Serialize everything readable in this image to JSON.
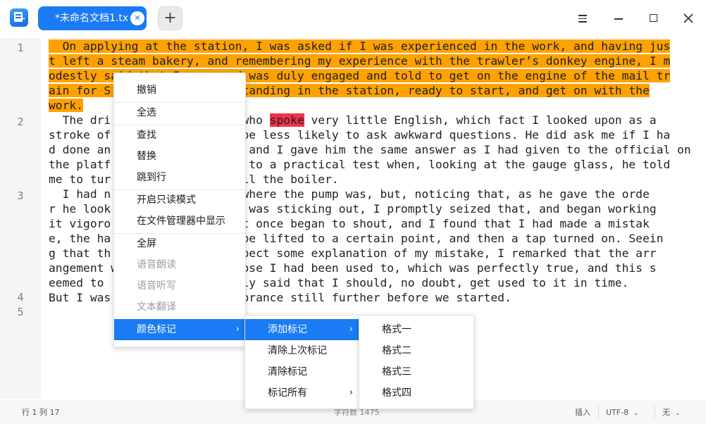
{
  "window": {
    "tab_title": "*未命名文档1.txt",
    "add_tab_label": "+",
    "close_tab_glyph": "✕",
    "buttons": [
      "menu-icon",
      "minimize-icon",
      "maximize-icon",
      "close-icon"
    ]
  },
  "editor": {
    "line_numbers": [
      "1",
      "2",
      "3",
      "4",
      "5"
    ],
    "lines": [
      {
        "parts": [
          {
            "text": "  On applying at the station, I was asked if I was experienced in the work, and having jus",
            "sel": true
          }
        ]
      },
      {
        "parts": [
          {
            "text": "t left a steam bakery, and remembering my experience with the trawler’s donkey engine, I m",
            "sel": true
          }
        ]
      },
      {
        "parts": [
          {
            "text": "odestly said that I was, and was duly engaged and told to get on the engine of the mail tr",
            "sel": true
          }
        ]
      },
      {
        "parts": [
          {
            "text": "ain for S...ead, which was standing in the station, ready to start, and get on with the",
            "sel": true
          }
        ]
      },
      {
        "parts": [
          {
            "text": "work.",
            "sel": true
          }
        ]
      },
      {
        "parts": [
          {
            "text": "  The dri...r was a native, who "
          },
          {
            "text": "spoke",
            "hl": true
          },
          {
            "text": " very little English, which fact I looked upon as a"
          }
        ]
      },
      {
        "parts": [
          {
            "text": "stroke of...ck, as he would be less likely to ask awkward questions. He did ask me if I ha"
          }
        ]
      },
      {
        "parts": [
          {
            "text": "d done an...ng in this line, and I gave him the same answer as I had given to the official on"
          }
        ]
      },
      {
        "parts": [
          {
            "text": "the platf...put my knowledge to a practical test when, looking at the gauge glass, he told"
          }
        ]
      },
      {
        "parts": [
          {
            "text": "me to tur...e injector to fill the boiler."
          }
        ]
      },
      {
        "parts": [
          {
            "text": "  I had n...e faintest idea where the pump was, but, noticing that, as he gave the orde"
          }
        ]
      },
      {
        "parts": [
          {
            "text": "r he look...ing handle which was sticking out, I promptly seized that, and began working"
          }
        ]
      },
      {
        "parts": [
          {
            "text": "it vigoro...p and down. He at once began to shout, and I found that I had made a mistak"
          }
        ]
      },
      {
        "parts": [
          {
            "text": "e, the ha...ing required to be lifted to a certain point, and then a tap turned on. Seein"
          }
        ]
      },
      {
        "parts": [
          {
            "text": "g that th...r appeared to expect some explanation of my mistake, I remarked that the arr"
          }
        ]
      },
      {
        "parts": [
          {
            "text": "angement w...fferent from those I had been used to, which was perfectly true, and this s"
          }
        ]
      },
      {
        "parts": [
          {
            "text": "eemed to ...him, for he merely said that I should, no doubt, get used to it in time."
          }
        ]
      },
      {
        "parts": [
          {
            "text": "But I was...to expose my ignorance still further before we started."
          }
        ]
      },
      {
        "parts": [
          {
            "text": ""
          }
        ]
      }
    ]
  },
  "context_menu": {
    "items": [
      {
        "label": "撤销",
        "enabled": true
      },
      {
        "label": "全选",
        "enabled": true
      },
      {
        "label": "查找",
        "enabled": true
      },
      {
        "label": "替换",
        "enabled": true
      },
      {
        "label": "跳到行",
        "enabled": true
      },
      {
        "label": "开启只读模式",
        "enabled": true
      },
      {
        "label": "在文件管理器中显示",
        "enabled": true
      },
      {
        "label": "全屏",
        "enabled": true
      },
      {
        "label": "语音朗读",
        "enabled": false
      },
      {
        "label": "语音听写",
        "enabled": false
      },
      {
        "label": "文本翻译",
        "enabled": false
      },
      {
        "label": "颜色标记",
        "enabled": true,
        "submenu": true,
        "active": true
      }
    ],
    "color_mark_submenu": [
      {
        "label": "添加标记",
        "submenu": true,
        "active": true
      },
      {
        "label": "清除上次标记"
      },
      {
        "label": "清除标记"
      },
      {
        "label": "标记所有",
        "submenu": true
      }
    ],
    "style_submenu": [
      "格式一",
      "格式二",
      "格式三",
      "格式四"
    ],
    "arrow_glyph": "›"
  },
  "statusbar": {
    "position": "行 1  列 17",
    "char_count": "字符数 1475",
    "input_mode": "插入",
    "encoding": "UTF-8",
    "highlight": "无",
    "chevron": "⌄"
  },
  "colors": {
    "accent": "#1a7bf4",
    "selection": "#ffa200",
    "mark": "#f2314c"
  }
}
